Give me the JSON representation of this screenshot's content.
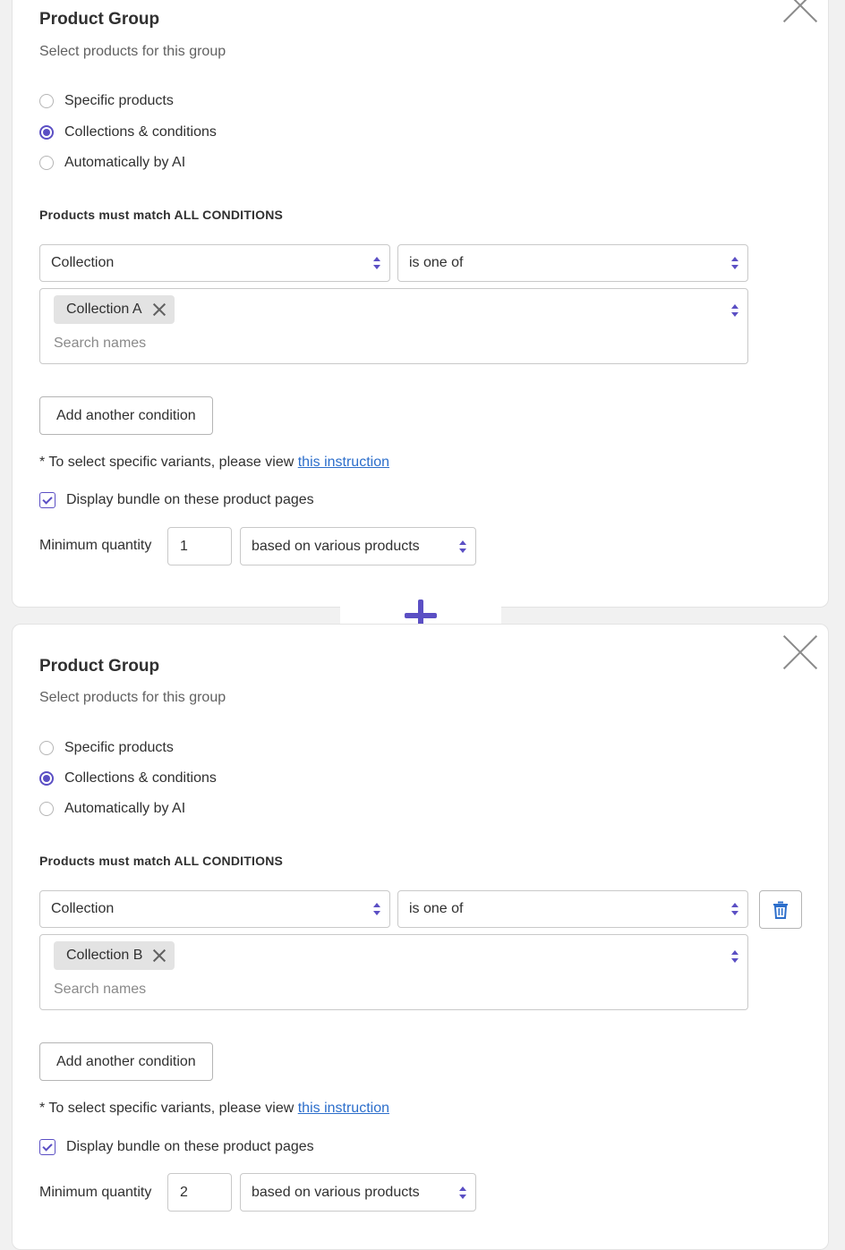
{
  "groups": [
    {
      "title": "Product Group",
      "subtitle": "Select products for this group",
      "options": [
        "Specific products",
        "Collections & conditions",
        "Automatically by AI"
      ],
      "selected_option": "Collections & conditions",
      "conditions_heading": "Products must match ALL CONDITIONS",
      "condition_field": "Collection",
      "condition_operator": "is one of",
      "tags": [
        "Collection A"
      ],
      "search_placeholder": "Search names",
      "add_condition_label": "Add another condition",
      "note_prefix": "* To select specific variants, please view",
      "note_link": "this instruction",
      "display_label": "Display bundle on these product pages",
      "display_checked": true,
      "min_qty_label": "Minimum quantity",
      "min_qty_value": "1",
      "qty_basis": "based on various products"
    },
    {
      "title": "Product Group",
      "subtitle": "Select products for this group",
      "options": [
        "Specific products",
        "Collections & conditions",
        "Automatically by AI"
      ],
      "selected_option": "Collections & conditions",
      "conditions_heading": "Products must match ALL CONDITIONS",
      "condition_field": "Collection",
      "condition_operator": "is one of",
      "tags": [
        "Collection B"
      ],
      "search_placeholder": "Search names",
      "add_condition_label": "Add another condition",
      "note_prefix": "* To select specific variants, please view",
      "note_link": "this instruction",
      "display_label": "Display bundle on these product pages",
      "display_checked": true,
      "min_qty_label": "Minimum quantity",
      "min_qty_value": "2",
      "qty_basis": "based on various products"
    }
  ],
  "icons": {
    "close": "close-icon",
    "add_group": "plus-icon",
    "delete_condition": "trash-icon",
    "tag_remove": "close-icon",
    "select": "chevron-up-down-icon",
    "check": "checkmark-icon"
  },
  "colors": {
    "accent": "#5b4fc4",
    "link": "#2c6ecb",
    "text": "#303030",
    "muted": "#616161",
    "border": "#c9c9c9"
  }
}
